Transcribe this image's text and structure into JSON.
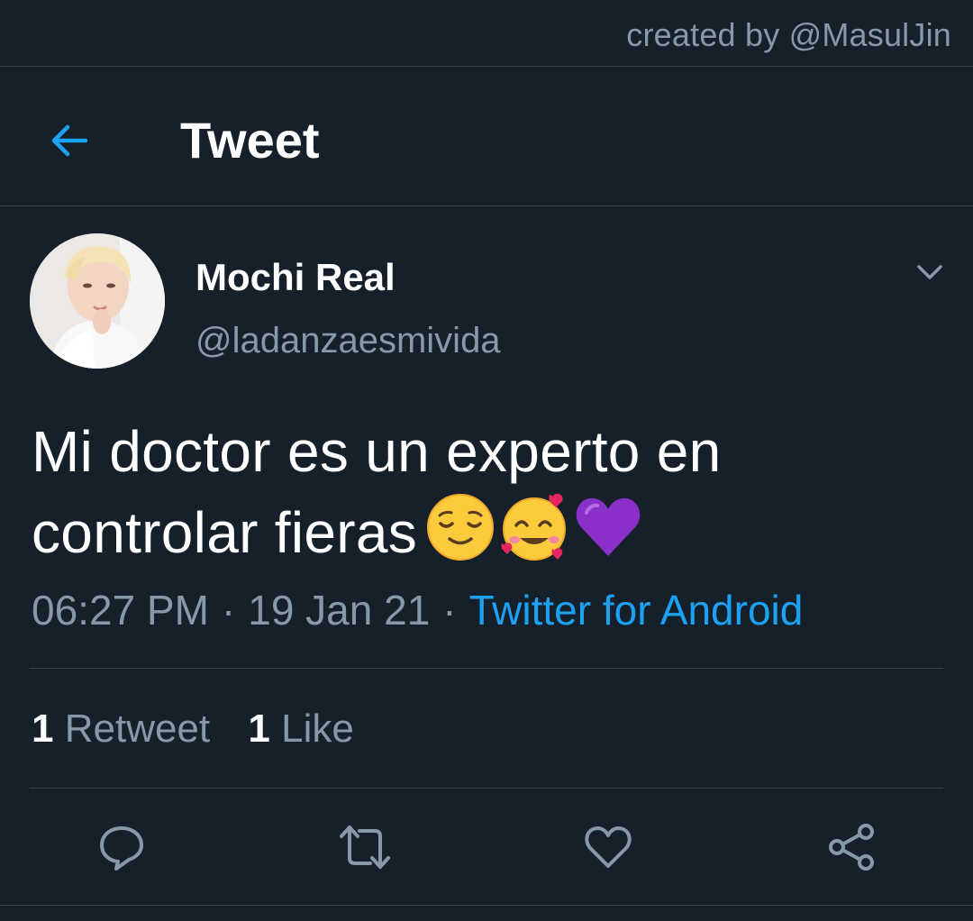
{
  "watermark": {
    "text": "created by @MasulJin"
  },
  "header": {
    "title": "Tweet",
    "back_icon": "arrow-left-icon"
  },
  "tweet": {
    "display_name": "Mochi Real",
    "handle": "@ladanzaesmivida",
    "text_line_1": "Mi doctor es un experto en",
    "text_line_2": "controlar fieras",
    "emojis": [
      "relieved-face-emoji",
      "smiling-face-with-hearts-emoji",
      "purple-heart-emoji"
    ],
    "time": "06:27 PM",
    "separator": "·",
    "date": "19 Jan 21",
    "client": "Twitter for Android"
  },
  "stats": {
    "retweet_count": "1",
    "retweet_label": "Retweet",
    "like_count": "1",
    "like_label": "Like"
  },
  "actions": {
    "icons": [
      "reply-icon",
      "retweet-icon",
      "like-icon",
      "share-icon"
    ]
  },
  "colors": {
    "background": "#15202b",
    "accent": "#1da1f2",
    "muted_text": "#8899a6",
    "divider": "#38444d",
    "primary_text": "#ffffff"
  }
}
